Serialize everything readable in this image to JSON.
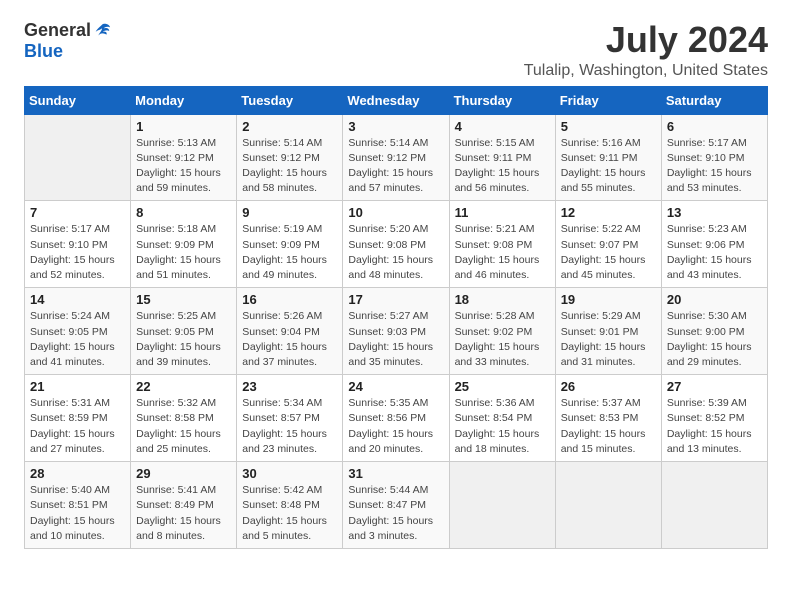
{
  "header": {
    "logo_general": "General",
    "logo_blue": "Blue",
    "month": "July 2024",
    "location": "Tulalip, Washington, United States"
  },
  "weekdays": [
    "Sunday",
    "Monday",
    "Tuesday",
    "Wednesday",
    "Thursday",
    "Friday",
    "Saturday"
  ],
  "weeks": [
    [
      {
        "day": "",
        "sunrise": "",
        "sunset": "",
        "daylight": ""
      },
      {
        "day": "1",
        "sunrise": "Sunrise: 5:13 AM",
        "sunset": "Sunset: 9:12 PM",
        "daylight": "Daylight: 15 hours and 59 minutes."
      },
      {
        "day": "2",
        "sunrise": "Sunrise: 5:14 AM",
        "sunset": "Sunset: 9:12 PM",
        "daylight": "Daylight: 15 hours and 58 minutes."
      },
      {
        "day": "3",
        "sunrise": "Sunrise: 5:14 AM",
        "sunset": "Sunset: 9:12 PM",
        "daylight": "Daylight: 15 hours and 57 minutes."
      },
      {
        "day": "4",
        "sunrise": "Sunrise: 5:15 AM",
        "sunset": "Sunset: 9:11 PM",
        "daylight": "Daylight: 15 hours and 56 minutes."
      },
      {
        "day": "5",
        "sunrise": "Sunrise: 5:16 AM",
        "sunset": "Sunset: 9:11 PM",
        "daylight": "Daylight: 15 hours and 55 minutes."
      },
      {
        "day": "6",
        "sunrise": "Sunrise: 5:17 AM",
        "sunset": "Sunset: 9:10 PM",
        "daylight": "Daylight: 15 hours and 53 minutes."
      }
    ],
    [
      {
        "day": "7",
        "sunrise": "Sunrise: 5:17 AM",
        "sunset": "Sunset: 9:10 PM",
        "daylight": "Daylight: 15 hours and 52 minutes."
      },
      {
        "day": "8",
        "sunrise": "Sunrise: 5:18 AM",
        "sunset": "Sunset: 9:09 PM",
        "daylight": "Daylight: 15 hours and 51 minutes."
      },
      {
        "day": "9",
        "sunrise": "Sunrise: 5:19 AM",
        "sunset": "Sunset: 9:09 PM",
        "daylight": "Daylight: 15 hours and 49 minutes."
      },
      {
        "day": "10",
        "sunrise": "Sunrise: 5:20 AM",
        "sunset": "Sunset: 9:08 PM",
        "daylight": "Daylight: 15 hours and 48 minutes."
      },
      {
        "day": "11",
        "sunrise": "Sunrise: 5:21 AM",
        "sunset": "Sunset: 9:08 PM",
        "daylight": "Daylight: 15 hours and 46 minutes."
      },
      {
        "day": "12",
        "sunrise": "Sunrise: 5:22 AM",
        "sunset": "Sunset: 9:07 PM",
        "daylight": "Daylight: 15 hours and 45 minutes."
      },
      {
        "day": "13",
        "sunrise": "Sunrise: 5:23 AM",
        "sunset": "Sunset: 9:06 PM",
        "daylight": "Daylight: 15 hours and 43 minutes."
      }
    ],
    [
      {
        "day": "14",
        "sunrise": "Sunrise: 5:24 AM",
        "sunset": "Sunset: 9:05 PM",
        "daylight": "Daylight: 15 hours and 41 minutes."
      },
      {
        "day": "15",
        "sunrise": "Sunrise: 5:25 AM",
        "sunset": "Sunset: 9:05 PM",
        "daylight": "Daylight: 15 hours and 39 minutes."
      },
      {
        "day": "16",
        "sunrise": "Sunrise: 5:26 AM",
        "sunset": "Sunset: 9:04 PM",
        "daylight": "Daylight: 15 hours and 37 minutes."
      },
      {
        "day": "17",
        "sunrise": "Sunrise: 5:27 AM",
        "sunset": "Sunset: 9:03 PM",
        "daylight": "Daylight: 15 hours and 35 minutes."
      },
      {
        "day": "18",
        "sunrise": "Sunrise: 5:28 AM",
        "sunset": "Sunset: 9:02 PM",
        "daylight": "Daylight: 15 hours and 33 minutes."
      },
      {
        "day": "19",
        "sunrise": "Sunrise: 5:29 AM",
        "sunset": "Sunset: 9:01 PM",
        "daylight": "Daylight: 15 hours and 31 minutes."
      },
      {
        "day": "20",
        "sunrise": "Sunrise: 5:30 AM",
        "sunset": "Sunset: 9:00 PM",
        "daylight": "Daylight: 15 hours and 29 minutes."
      }
    ],
    [
      {
        "day": "21",
        "sunrise": "Sunrise: 5:31 AM",
        "sunset": "Sunset: 8:59 PM",
        "daylight": "Daylight: 15 hours and 27 minutes."
      },
      {
        "day": "22",
        "sunrise": "Sunrise: 5:32 AM",
        "sunset": "Sunset: 8:58 PM",
        "daylight": "Daylight: 15 hours and 25 minutes."
      },
      {
        "day": "23",
        "sunrise": "Sunrise: 5:34 AM",
        "sunset": "Sunset: 8:57 PM",
        "daylight": "Daylight: 15 hours and 23 minutes."
      },
      {
        "day": "24",
        "sunrise": "Sunrise: 5:35 AM",
        "sunset": "Sunset: 8:56 PM",
        "daylight": "Daylight: 15 hours and 20 minutes."
      },
      {
        "day": "25",
        "sunrise": "Sunrise: 5:36 AM",
        "sunset": "Sunset: 8:54 PM",
        "daylight": "Daylight: 15 hours and 18 minutes."
      },
      {
        "day": "26",
        "sunrise": "Sunrise: 5:37 AM",
        "sunset": "Sunset: 8:53 PM",
        "daylight": "Daylight: 15 hours and 15 minutes."
      },
      {
        "day": "27",
        "sunrise": "Sunrise: 5:39 AM",
        "sunset": "Sunset: 8:52 PM",
        "daylight": "Daylight: 15 hours and 13 minutes."
      }
    ],
    [
      {
        "day": "28",
        "sunrise": "Sunrise: 5:40 AM",
        "sunset": "Sunset: 8:51 PM",
        "daylight": "Daylight: 15 hours and 10 minutes."
      },
      {
        "day": "29",
        "sunrise": "Sunrise: 5:41 AM",
        "sunset": "Sunset: 8:49 PM",
        "daylight": "Daylight: 15 hours and 8 minutes."
      },
      {
        "day": "30",
        "sunrise": "Sunrise: 5:42 AM",
        "sunset": "Sunset: 8:48 PM",
        "daylight": "Daylight: 15 hours and 5 minutes."
      },
      {
        "day": "31",
        "sunrise": "Sunrise: 5:44 AM",
        "sunset": "Sunset: 8:47 PM",
        "daylight": "Daylight: 15 hours and 3 minutes."
      },
      {
        "day": "",
        "sunrise": "",
        "sunset": "",
        "daylight": ""
      },
      {
        "day": "",
        "sunrise": "",
        "sunset": "",
        "daylight": ""
      },
      {
        "day": "",
        "sunrise": "",
        "sunset": "",
        "daylight": ""
      }
    ]
  ]
}
